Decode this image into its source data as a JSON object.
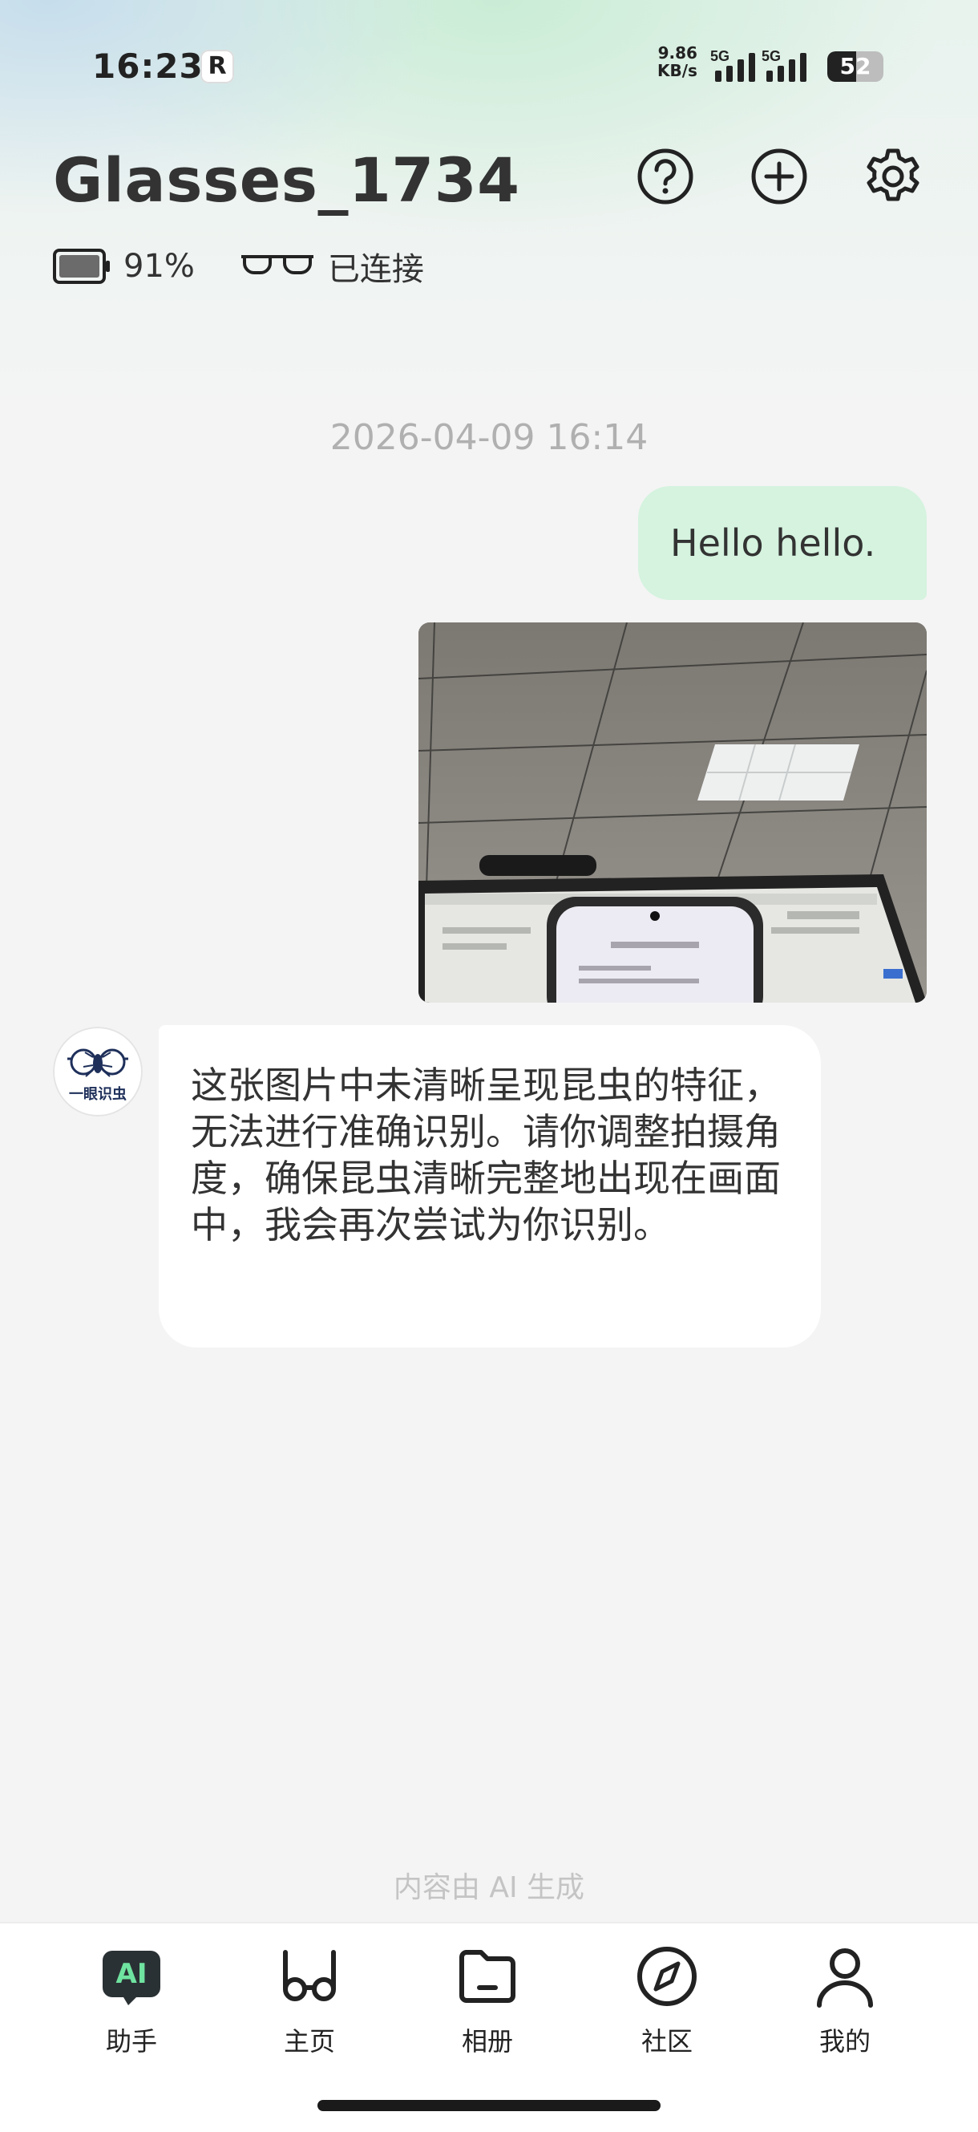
{
  "status_bar": {
    "time": "16:23",
    "app_badge": "R",
    "net_speed_value": "9.86",
    "net_speed_unit": "KB/s",
    "sim1_label": "5G",
    "sim2_label": "5G",
    "battery_level": "52"
  },
  "header": {
    "title": "Glasses_1734",
    "battery_percent": "91%",
    "connection_status": "已连接",
    "icons": [
      "help-icon",
      "add-icon",
      "settings-icon"
    ]
  },
  "chat": {
    "timestamp": "2026-04-09 16:14",
    "user_message": "Hello hello.",
    "photo_icon": "captured-photo",
    "bot_avatar_label": "一眼识虫",
    "bot_message": "这张图片中未清晰呈现昆虫的特征，无法进行准确识别。请你调整拍摄角度，确保昆虫清晰完整地出现在画面中，我会再次尝试为你识别。"
  },
  "ai_note": "内容由 AI 生成",
  "tabs": [
    {
      "label": "助手",
      "badge": "AI",
      "icon": "ai-assistant-icon",
      "active": true
    },
    {
      "label": "主页",
      "icon": "glasses-icon"
    },
    {
      "label": "相册",
      "icon": "folder-icon"
    },
    {
      "label": "社区",
      "icon": "compass-icon"
    },
    {
      "label": "我的",
      "icon": "person-icon"
    }
  ],
  "colors": {
    "user_bubble": "#d5f3df",
    "bot_bubble": "#ffffff",
    "ai_badge_bg": "#2a3134",
    "ai_badge_text": "#6fe3a0"
  }
}
